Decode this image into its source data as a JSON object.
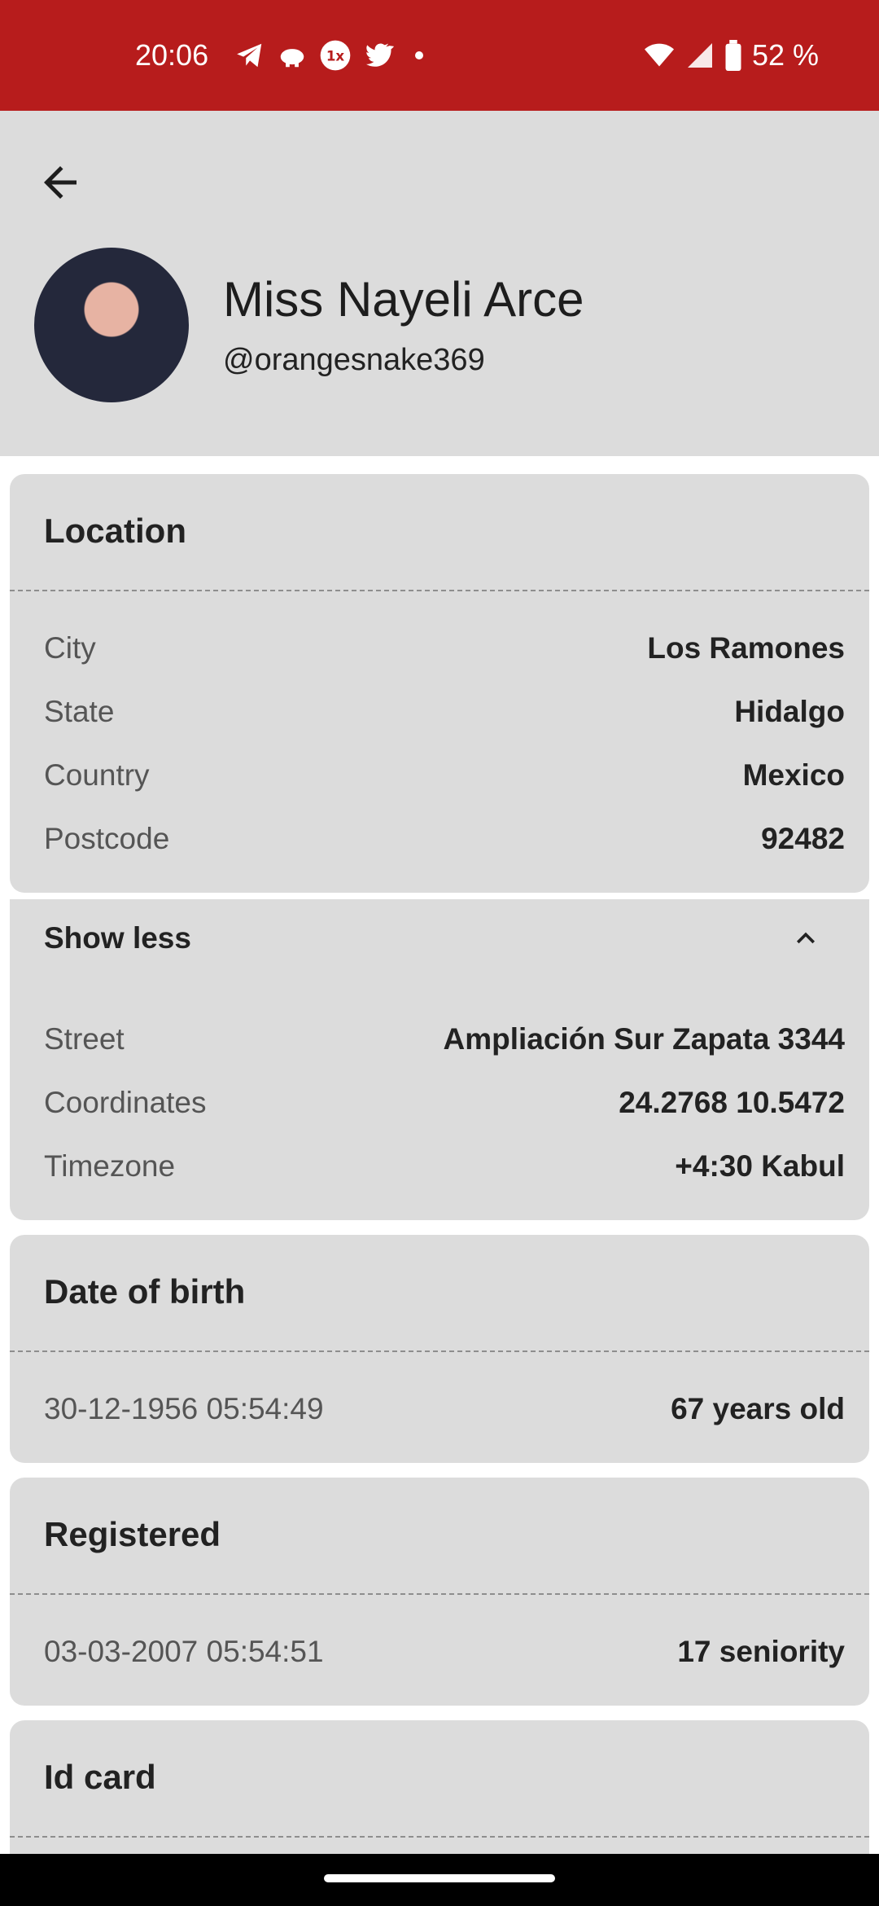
{
  "status": {
    "time": "20:06",
    "battery": "52 %"
  },
  "profile": {
    "name": "Miss Nayeli Arce",
    "handle": "@orangesnake369"
  },
  "location": {
    "title": "Location",
    "rows": [
      {
        "label": "City",
        "value": "Los Ramones"
      },
      {
        "label": "State",
        "value": "Hidalgo"
      },
      {
        "label": "Country",
        "value": "Mexico"
      },
      {
        "label": "Postcode",
        "value": "92482"
      }
    ],
    "toggle_label": "Show less",
    "extra_rows": [
      {
        "label": "Street",
        "value": "Ampliación Sur Zapata 3344"
      },
      {
        "label": "Coordinates",
        "value": "24.2768 10.5472"
      },
      {
        "label": "Timezone",
        "value": "+4:30 Kabul"
      }
    ]
  },
  "birth": {
    "title": "Date of birth",
    "date": "30-12-1956 05:54:49",
    "age": "67 years old"
  },
  "registered": {
    "title": "Registered",
    "date": "03-03-2007 05:54:51",
    "seniority": "17 seniority"
  },
  "idcard": {
    "title": "Id card"
  },
  "icons": [
    "telegram-icon",
    "piggy-bank-icon",
    "onex-icon",
    "twitter-icon",
    "dot-icon",
    "wifi-icon",
    "signal-icon",
    "battery-icon",
    "back-arrow-icon",
    "chevron-up-icon"
  ],
  "colors": {
    "statusbar": "#b71c1c",
    "card": "#dcdcdc"
  }
}
